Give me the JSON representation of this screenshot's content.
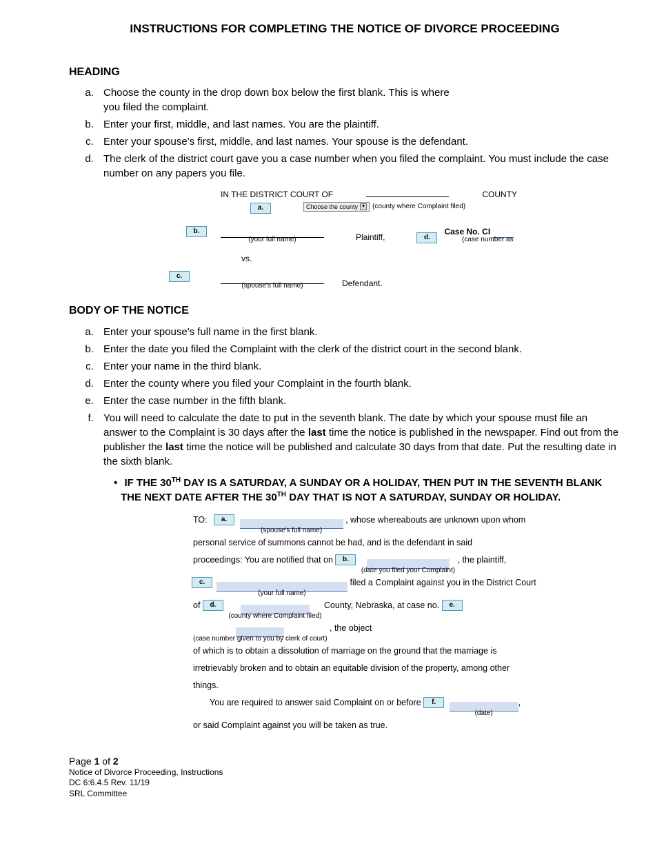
{
  "title": "INSTRUCTIONS FOR COMPLETING THE NOTICE OF DIVORCE PROCEEDING",
  "sections": {
    "heading": {
      "label": "HEADING",
      "items": [
        "Choose the county in the drop down box below the first blank. This is where you filed the complaint.",
        "Enter your first, middle, and last names. You are the plaintiff.",
        "Enter your spouse's first, middle, and last names. Your spouse is the defendant.",
        "The clerk of the district court gave you a case number when you filed the complaint. You must include the case number on any papers you file."
      ]
    },
    "body": {
      "label": "BODY OF THE NOTICE",
      "items": [
        "Enter your spouse's full name in the first blank.",
        "Enter the date you filed the Complaint with the clerk of the district court in the second blank.",
        "Enter your name in the third blank.",
        "Enter the county where you filed your Complaint in the fourth blank.",
        "Enter the case number in the fifth blank."
      ],
      "item_f_parts": {
        "p1": "You will need to calculate the date to put in the seventh blank. The date by which your spouse must file an answer to the Complaint is 30 days after the ",
        "p2": " time the notice is published in the newspaper. Find out from the publisher the ",
        "p3": " time the notice will be published and calculate 30 days from that date. Put the resulting date in the sixth blank.",
        "last_word": "last"
      },
      "note_parts": {
        "a": "IF THE 30",
        "th": "TH",
        "b": " DAY IS A SATURDAY, A SUNDAY OR A HOLIDAY, THEN PUT IN THE SEVENTH BLANK THE NEXT DATE AFTER THE 30",
        "c": " DAY THAT IS NOT A SATURDAY, SUNDAY OR HOLIDAY."
      }
    }
  },
  "form1": {
    "line1_left": "IN THE DISTRICT COURT OF",
    "line1_right": "COUNTY",
    "dropdown": "Choose the county",
    "county_caption": "(county where Complaint filed)",
    "your_name_caption": "(your full name)",
    "plaintiff": "Plaintiff,",
    "case_no": "Case No. CI",
    "case_caption": "(case number as",
    "vs": "vs.",
    "spouse_caption": "(spouse's full name)",
    "defendant": "Defendant.",
    "markers": {
      "a": "a.",
      "b": "b.",
      "c": "c.",
      "d": "d."
    }
  },
  "form2": {
    "to": "TO:",
    "spouse_caption": "(spouse's full name)",
    "l1_tail": ", whose whereabouts are unknown upon whom",
    "l2": "personal service of summons cannot be had, and is the defendant in said",
    "l3_a": "proceedings: You are notified that on ",
    "date_caption": "(date you filed your Complaint)",
    "l3_b": ", the plaintiff,",
    "your_name_caption": "(your full name)",
    "l4_tail": " filed a Complaint against you in the District Court",
    "l5_a": "of ",
    "county_caption": "(county where Complaint filed)",
    "l5_b": " County, Nebraska, at case no. ",
    "caseno_caption": "(case number given to you by clerk of court)",
    "l5_c": ", the object",
    "l6": "of which is to obtain a dissolution of marriage on the ground that the marriage is",
    "l7": "irretrievably broken and to obtain an equitable division of the property, among other",
    "l8": "things.",
    "l9_a": "You are required to answer said Complaint on or before ",
    "date2_caption": "(date)",
    "l10": "or said Complaint against you will be taken as true.",
    "markers": {
      "a": "a.",
      "b": "b.",
      "c": "c.",
      "d": "d.",
      "e": "e.",
      "f": "f."
    }
  },
  "footer": {
    "page_a": "Page ",
    "page_n": "1",
    "page_of": " of ",
    "page_t": "2",
    "line2": "Notice of Divorce Proceeding, Instructions",
    "line3": "DC 6:6.4.5 Rev. 11/19",
    "line4": "SRL Committee"
  }
}
